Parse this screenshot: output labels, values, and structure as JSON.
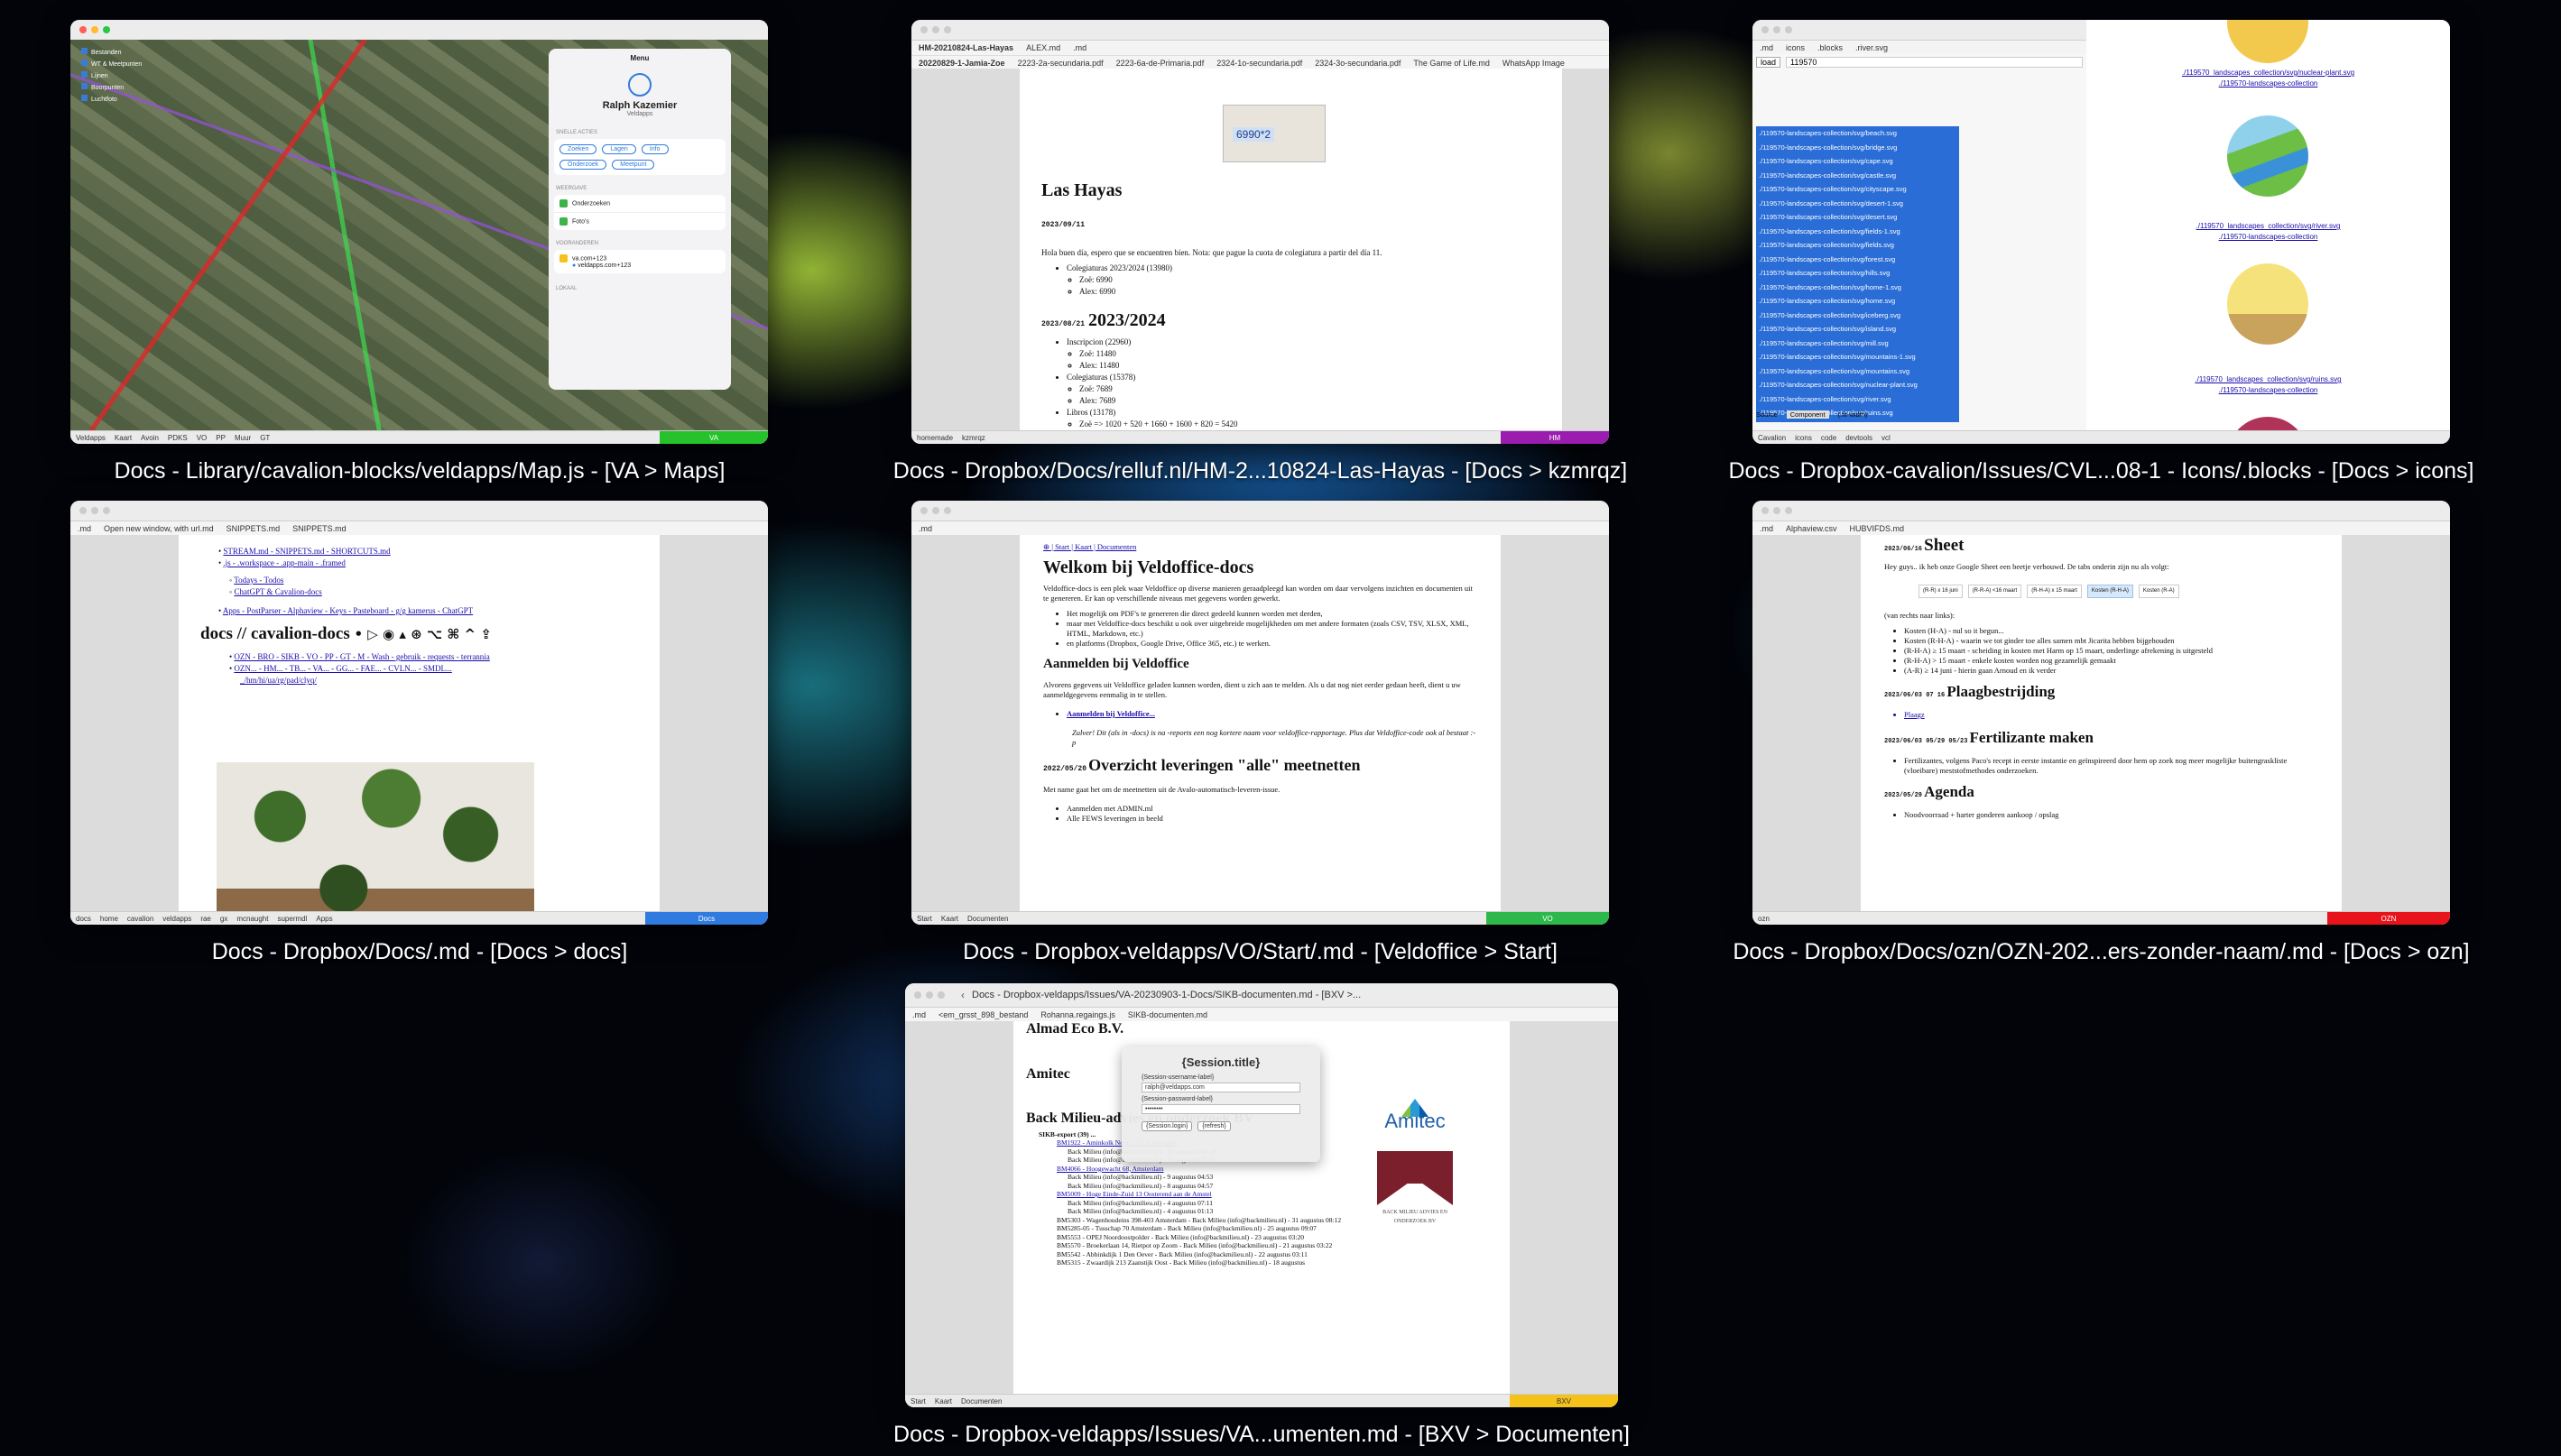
{
  "captions": [
    "Docs - Library/cavalion-blocks/veldapps/Map.js - [VA > Maps]",
    "Docs - Dropbox/Docs/relluf.nl/HM-2...10824-Las-Hayas - [Docs > kzmrqz]",
    "Docs - Dropbox-cavalion/Issues/CVL...08-1 - Icons/.blocks - [Docs > icons]",
    "Docs - Dropbox/Docs/.md - [Docs > docs]",
    "Docs - Dropbox-veldapps/VO/Start/.md - [Veldoffice > Start]",
    "Docs - Dropbox/Docs/ozn/OZN-202...ers-zonder-naam/.md - [Docs > ozn]",
    "Docs - Dropbox-veldapps/Issues/VA...umenten.md - [BXV > Documenten]"
  ],
  "w1": {
    "menu_title": "Menu",
    "user_name": "Ralph Kazemier",
    "user_org": "Veldapps",
    "section_favorites": "SNELLE ACTIES",
    "pills": [
      "Zoeken",
      "Lagen",
      "Info",
      "Onderzoek",
      "Meetpunt"
    ],
    "section_views": "WEERGAVE",
    "items": [
      "Onderzoeken",
      "Foto's"
    ],
    "section_recent": "VOORANDEREN",
    "recent_1": "va.com+123",
    "recent_2": "veldapps.com+123",
    "section_local": "LOKAAL",
    "layers": [
      "Bestanden",
      "WT & Meetpunten",
      "Lijnen",
      "Boorpunten",
      "Luchtfoto"
    ],
    "status": [
      "Veldapps",
      "Kaart",
      "Avoin",
      "PDKS",
      "VO",
      "PP",
      "Muur",
      "GT"
    ],
    "badge": "VA"
  },
  "w2": {
    "tabs": [
      "HM-20210824-Las-Hayas",
      "ALEX.md",
      ".md"
    ],
    "subtabs": [
      "20220829-1-Jamia-Zoe",
      "2223-2a-secundaria.pdf",
      "2223-6a-de-Primaria.pdf",
      "2324-1o-secundaria.pdf",
      "2324-3o-secundaria.pdf",
      "The Game of Life.md",
      "WhatsApp Image"
    ],
    "image_amount": "6990*2",
    "title": "Las Hayas",
    "date1": "2023/09/11",
    "greeting": "Hola buen día, espero que se encuentren bien. Nota: que pague la cuota de colegiatura a partir del día 11.",
    "list1": [
      "Colegiaturas 2023/2024 (13980)",
      "Zoë: 6990",
      "Alex: 6990"
    ],
    "date2": "2023/08/21",
    "h2": "2023/2024",
    "list2": [
      "Inscripcion (22960)",
      "Zoë: 11480",
      "Alex: 11480",
      "Colegiaturas (15378)",
      "Zoë: 7689",
      "Alex: 7689",
      "Libros (13178)",
      "Zoë => 1020 + 520 + 1660 + 1600 + 820 = 5420"
    ],
    "status": [
      "homemade",
      "kzmrqz"
    ],
    "badge": "HM"
  },
  "w3": {
    "tabs": [
      ".md",
      "icons",
      ".blocks",
      ".river.svg"
    ],
    "path_label": "load",
    "search": "119570",
    "files": [
      "./119570-landscapes-collection/svg/beach.svg",
      "./119570-landscapes-collection/svg/bridge.svg",
      "./119570-landscapes-collection/svg/cape.svg",
      "./119570-landscapes-collection/svg/castle.svg",
      "./119570-landscapes-collection/svg/cityscape.svg",
      "./119570-landscapes-collection/svg/desert-1.svg",
      "./119570-landscapes-collection/svg/desert.svg",
      "./119570-landscapes-collection/svg/fields-1.svg",
      "./119570-landscapes-collection/svg/fields.svg",
      "./119570-landscapes-collection/svg/forest.svg",
      "./119570-landscapes-collection/svg/hills.svg",
      "./119570-landscapes-collection/svg/home-1.svg",
      "./119570-landscapes-collection/svg/home.svg",
      "./119570-landscapes-collection/svg/iceberg.svg",
      "./119570-landscapes-collection/svg/island.svg",
      "./119570-landscapes-collection/svg/mill.svg",
      "./119570-landscapes-collection/svg/mountains-1.svg",
      "./119570-landscapes-collection/svg/mountains.svg",
      "./119570-landscapes-collection/svg/nuclear-plant.svg",
      "./119570-landscapes-collection/svg/river.svg",
      "./119570-landscapes-collection/svg/ruins.svg"
    ],
    "icon_links": [
      "./119570_landscapes_collection/svg/nuclear-plant.svg",
      "./119570-landscapes-collection",
      "./119570_landscapes_collection/svg/river.svg",
      "./119570-landscapes-collection",
      "./119570_landscapes_collection/svg/ruins.svg",
      "./119570-landscapes-collection"
    ],
    "bottom_tabs": [
      "Source",
      "Component",
      "(.fit-width)"
    ],
    "status": [
      "Cavalion",
      "icons",
      "code",
      "devtools",
      "vcl"
    ]
  },
  "w4": {
    "tabs": [
      ".md",
      "Open new window, with url.md",
      "SNIPPETS.md",
      "SNIPPETS.md"
    ],
    "links1": "STREAM.md - SNIPPETS.md - SHORTCUTS.md",
    "links2": ".js - .workspace - .app-main - .framed",
    "links3": "Todays - Todos",
    "links4": "ChatGPT & Cavalion-docs",
    "links5": "Apps - PostParser - Alphaview - Keys - Pasteboard - g/g kamerus - ChatGPT",
    "title": "docs // cavalion-docs",
    "title_symbols": "• ▷ ◉ ▴ ⊛ ⌥ ⌘ ^ ⇪",
    "links6": "OZN - BRO - SIKB - VO - PP - GT - M - Wash - gebruik - requests - terrannia",
    "links7": "OZN... - HM... - TB... - VA... - GG... - FAE... - CVLN... - SMDL...",
    "links8": "_/hm/hi/ua/rg/pad/clyq/",
    "status": [
      "docs",
      "home",
      "cavalion",
      "veldapps",
      "rae",
      "gx",
      "mcnaught",
      "supermdl",
      "Apps"
    ],
    "badge": "Docs"
  },
  "w5": {
    "tabs": [
      ".md"
    ],
    "breadcrumb": "⊕ | Start | Kaart | Documenten",
    "title": "Welkom bij Veldoffice-docs",
    "intro": "Veldoffice-docs is een plek waar Veldoffice op diverse manieren geraadpleegd kan worden om daar vervolgens inzichten en documenten uit te genereren. Er kan op verschillende niveaus met gegevens worden gewerkt.",
    "bullets": [
      "Het mogelijk om PDF's te genereren die direct gedeeld kunnen worden met derden,",
      "maar met Veldoffice-docs beschikt u ook over uitgebreide mogelijkheden om met andere formaten (zoals CSV, TSV, XLSX, XML, HTML, Markdown, etc.)",
      "en platforms (Dropbox, Google Drive, Office 365, etc.) te werken."
    ],
    "h2a": "Aanmelden bij Veldoffice",
    "p2": "Alvorens gegevens uit Veldoffice geladen kunnen worden, dient u zich aan te melden. Als u dat nog niet eerder gedaan heeft, dient u uw aanmeldgegevens eenmalig in te stellen.",
    "login_link": "Aanmelden bij Veldoffice...",
    "note": "Zulver! Dit (als in -docs) is na -reports een nog kortere naam voor veldoffice-rapportage. Plus dat Veldoffice-code ook al bestaat :-p",
    "date": "2022/05/20",
    "h2b": "Overzicht leveringen \"alle\" meetnetten",
    "p3": "Met name gaat het om de meetnetten uit de Avalo-automatisch-leveren-issue.",
    "list3": [
      "Aanmelden met ADMIN.ml",
      "Alle FEWS leveringen in beeld"
    ],
    "status": [
      "Start",
      "Kaart",
      "Documenten"
    ],
    "badge": "VO"
  },
  "w6": {
    "tabs": [
      ".md",
      "Alphaview.csv",
      "HUBVIFDS.md"
    ],
    "date1": "2023/06/16",
    "h1": "Sheet",
    "p1": "Hey guys.. ik heb onze Google Sheet een beetje verbouwd. De tabs onderin zijn nu als volgt:",
    "chips": [
      "(R-R) x 16 juni",
      "(R-R-A) <16 maart",
      "(R-H-A) x 15 maart",
      "Kosten (R-H-A)",
      "Kosten (R-A)"
    ],
    "p2": "(van rechts naar links):",
    "list1": [
      "Kosten (H-A) - nul so it begun...",
      "Kosten (R-H-A) - waarin we tot ginder toe alles samen mbt Jicarita hebben bijgehouden",
      "(R-H-A) ≥ 15 maart - scheiding in kosten met Harm op 15 maart, onderlinge afrekening is uitgesteld",
      "(R-H-A) > 15 maart - enkele kosten worden nog gezamelijk gemaakt",
      "(A-R) ≥ 14 juni - hierin gaan Arnoud en ik verder"
    ],
    "date2": "2023/06/03 07 16",
    "h2": "Plaagbestrijding",
    "list2": [
      "Plaagz"
    ],
    "date3": "2023/06/03 05/29 05/23",
    "h3": "Fertilizante maken",
    "list3": "Fertilizantes, volgens Paco's recept in eerste instantie en geïnspireerd door hem op zoek nog meer mogelijke buitengraskliste (vloeibare) meststofmethodes onderzoeken.",
    "date4": "2023/05/29",
    "h4": "Agenda",
    "list4": "Noodvoorraad + harter gonderen aankoop / opslag",
    "status": [
      "ozn"
    ],
    "badge": "OZN"
  },
  "w7": {
    "title": "Docs - Dropbox-veldapps/Issues/VA-20230903-1-Docs/SIKB-documenten.md - [BXV >...",
    "tabs": [
      ".md",
      "<em_grsst_898_bestand",
      "Rohanna.regaings.js",
      "SIKB-documenten.md"
    ],
    "h1a": "Almad Eco B.V.",
    "h1b": "Amitec",
    "h1c": "Back Milieu-advies en onderzoek BV",
    "dialog_title": "{Session.title}",
    "dialog_user_label": "{Session-username-label}",
    "dialog_user": "ralph@veldapps.com",
    "dialog_pw_label": "{Session-password-label}",
    "dialog_pw": "••••••••",
    "btn_login": "{Session.login}",
    "btn_other": "{refresh}",
    "export": "SIKB-export (39) ...",
    "rows": [
      "BM1922 - Aminkolk Noord 165 Amsterdam",
      "Back Milieu (info@backmilieu.nl) - 15 augustus 06:29",
      "Back Milieu (info@backmilieu.nl) - 14 augustus 05:45",
      "BM4066 - Hoogewacht 68, Amsterdam",
      "Back Milieu (info@backmilieu.nl) - 9 augustus 04:53",
      "Back Milieu (info@backmilieu.nl) - 8 augustus 04:57",
      "BM5009 - Hoge Einde-Zuid 13 Oosterend aan de Amstel",
      "Back Milieu (info@backmilieu.nl) - 4 augustus 07:11",
      "Back Milieu (info@backmilieu.nl) - 4 augustus 01:13",
      "BM5303 - Wagenhoudeins 398-403 Amsterdam - Back Milieu (info@backmilieu.nl) - 31 augustus 08:12",
      "BM5285-05 - Tusschap 70 Amsterdam - Back Milieu (info@backmilieu.nl) - 25 augustus 09:07",
      "BM5553 - OPEJ Noordoostpolder - Back Milieu (info@backmilieu.nl) - 23 augustus 03:20",
      "BM5570 - Broekerlaan 14, Rietpot op Zoom - Back Milieu (info@backmilieu.nl) - 21 augustus 03:22",
      "BM5542 - Abbinkdijk 1 Den Oever - Back Milieu (info@backmilieu.nl) - 22 augustus 03:11",
      "BM5315 - Zwaardijk 213 Zaanstijk Oost - Back Milieu (info@backmilieu.nl) - 18 augustus"
    ],
    "logo_amitec": "Amitec",
    "logo_back": "BACK MILIEU ADVIES EN ONDERZOEK BV",
    "status": [
      "Start",
      "Kaart",
      "Documenten"
    ],
    "badge": "BXV"
  },
  "colors": {
    "va": "#26c22b",
    "hm": "#9b1db0",
    "docs": "#2f7be0",
    "vo": "#2db84c",
    "ozn": "#e8141c",
    "bxv": "#f4c21b"
  }
}
